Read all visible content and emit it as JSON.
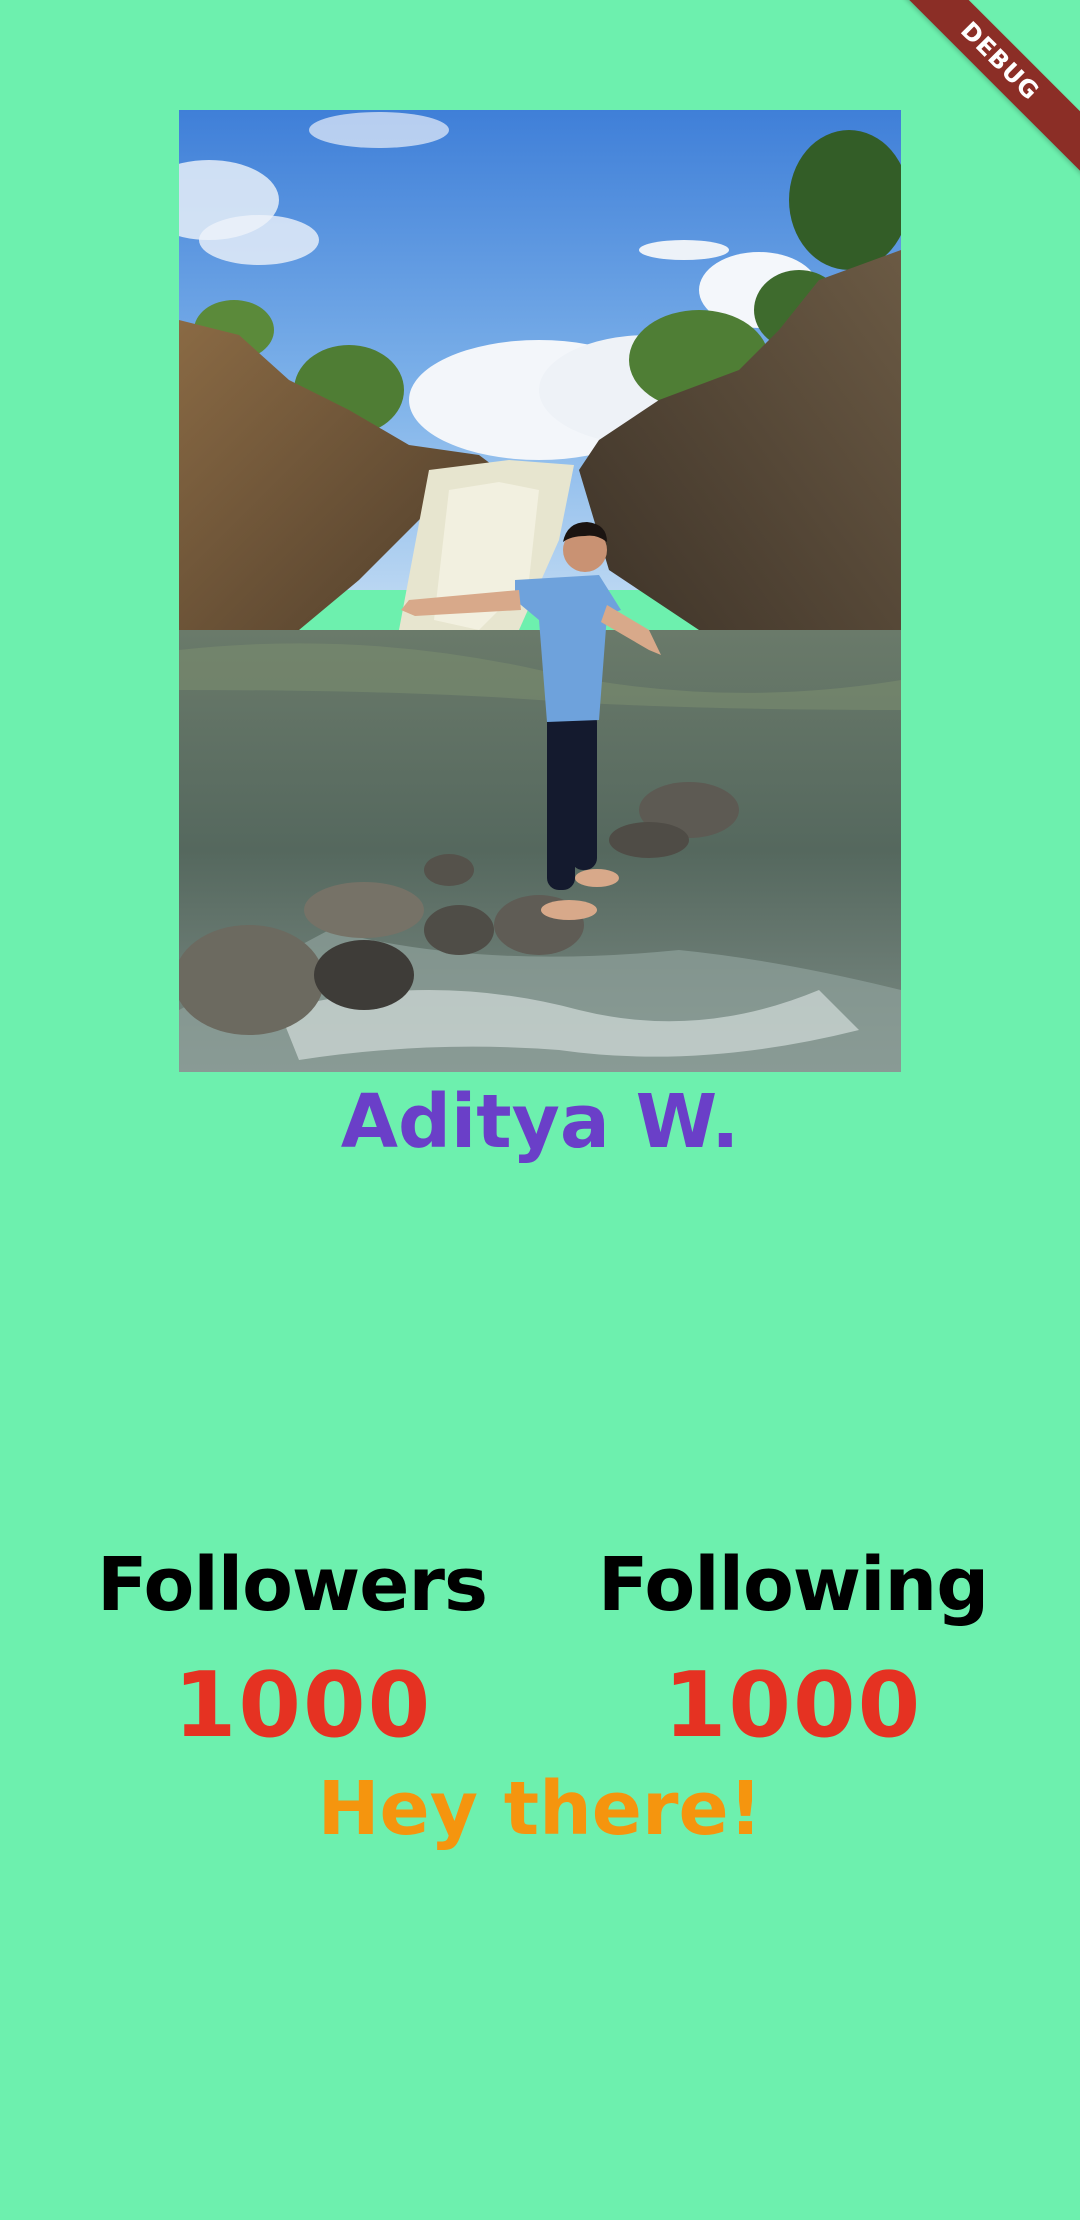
{
  "app": {
    "background_color": "#6df0ae",
    "debug_banner": "DEBUG"
  },
  "profile": {
    "photo_icon": "profile-photo",
    "name": "Aditya W.",
    "name_color": "#6a3fc8"
  },
  "stats": {
    "followers": {
      "label": "Followers",
      "value": "1000"
    },
    "following": {
      "label": "Following",
      "value": "1000"
    },
    "label_color": "#000000",
    "value_color": "#e53222"
  },
  "greeting": {
    "text": "Hey there!",
    "color": "#f5950e"
  }
}
